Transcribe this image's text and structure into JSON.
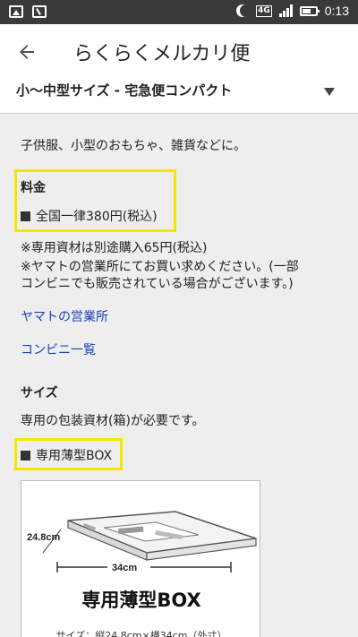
{
  "statusbar": {
    "network": "4G",
    "time": "0:13"
  },
  "appbar": {
    "title": "らくらくメルカリ便"
  },
  "dropdown": {
    "selected": "小〜中型サイズ - 宅急便コンパクト"
  },
  "content": {
    "description": "子供服、小型のおもちゃ、雑貨などに。",
    "fee_title": "料金",
    "fee_price": "全国一律380円(税込)",
    "note_line1": "※専用資材は別途購入65円(税込)",
    "note_line2": "※ヤマトの営業所にてお買い求めください。(一部",
    "note_line3": "コンビニでも販売されている場合がございます。)",
    "link_yamato": "ヤマトの営業所",
    "link_konbini": "コンビニ一覧",
    "size_title": "サイズ",
    "size_desc": "専用の包装資材(箱)が必要です。",
    "box_label": "専用薄型BOX"
  },
  "product_image": {
    "dim_depth": "24.8cm",
    "dim_width": "34cm",
    "caption": "専用薄型BOX",
    "sub_caption": "サイズ：縦24.8cm×横34cm（外寸）"
  }
}
